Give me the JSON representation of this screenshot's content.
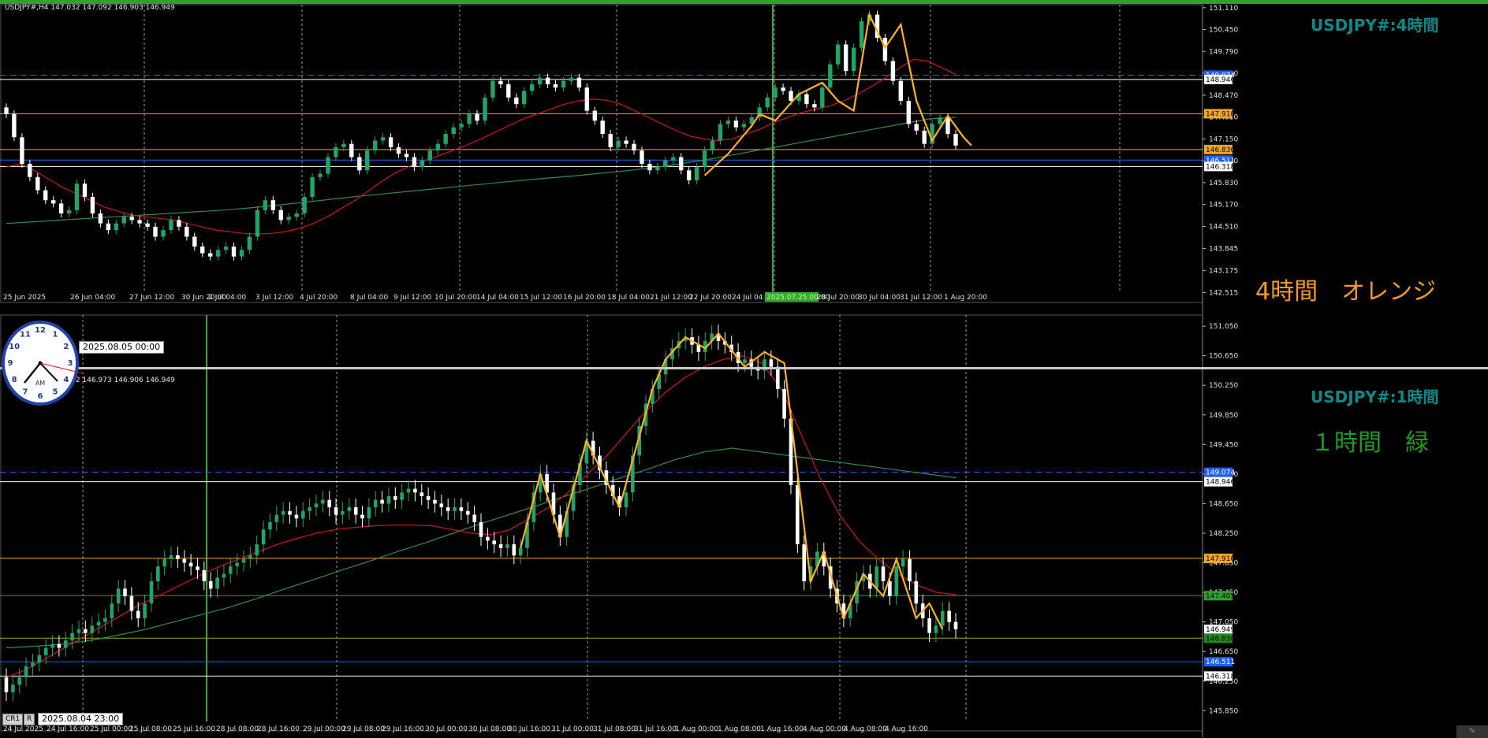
{
  "symbol": "USDJPY#",
  "colors": {
    "bull": "#21a567",
    "bear": "#ffffff",
    "ema_red": "#d11414",
    "ema_green": "#2e8b57",
    "zigzag": "#ffb020",
    "orange_line": "#f5a623",
    "blue_line": "#1e5eff",
    "white_line": "#ffffff",
    "green_line": "#2ea02e",
    "vgrid": "#9a9a9a",
    "accent_green": "#36a836"
  },
  "panels": [
    {
      "id": "h4",
      "info_text": "USDJPY#,H4  147.032 147.092 146.903 146.949",
      "title": "USDJPY#:4時間",
      "note": "4時間　オレンジ",
      "note_color": "#f59a1a",
      "y_ticks": [
        151.11,
        150.45,
        149.79,
        149.13,
        148.47,
        147.81,
        147.15,
        146.49,
        145.83,
        145.17,
        144.51,
        143.845,
        143.175,
        142.515
      ],
      "y_tick_labels": [
        "151.110",
        "150.450",
        "149.790",
        "149.130",
        "148.470",
        "147.810",
        "147.150",
        "146.490",
        "145.830",
        "145.170",
        "144.510",
        "143.845",
        "143.175",
        "142.515"
      ],
      "ylim": [
        142.5,
        151.2
      ],
      "x_labels": [
        "25 Jun 2025",
        "26 Jun 04:00",
        "27 Jun 12:00",
        "30 Jun 20:00",
        "2 Jul 04:00",
        "3 Jul 12:00",
        "4 Jul 20:00",
        "8 Jul 04:00",
        "9 Jul 12:00",
        "10 Jul 20:00",
        "14 Jul 04:00",
        "15 Jul 12:00",
        "16 Jul 20:00",
        "18 Jul 04:00",
        "21 Jul 12:00",
        "22 Jul 20:00",
        "24 Jul 04:00",
        "2025.07.25 00:00",
        "28 Jul 20:00",
        "30 Jul 04:00",
        "31 Jul 12:00",
        "1 Aug 20:00"
      ],
      "levels": [
        {
          "price": 149.074,
          "kind": "blue_dash",
          "label": "149.074"
        },
        {
          "price": 148.946,
          "kind": "white",
          "label": "148.946"
        },
        {
          "price": 147.91,
          "kind": "orange",
          "label": "147.910"
        },
        {
          "price": 146.83,
          "kind": "orange",
          "label": "146.830"
        },
        {
          "price": 146.511,
          "kind": "blue",
          "label": "146.511"
        },
        {
          "price": 146.318,
          "kind": "white",
          "label": "146.318"
        }
      ],
      "datetime_box": "2025.08.05 00:00",
      "chart_data": {
        "type": "candlestick",
        "title": "USDJPY#:4時間",
        "note": "4時間　オレンジ",
        "close": [
          147.9,
          147.2,
          146.4,
          146.0,
          145.6,
          145.3,
          145.2,
          144.9,
          145.0,
          145.8,
          145.4,
          144.9,
          144.6,
          144.4,
          144.6,
          144.8,
          144.7,
          144.6,
          144.5,
          144.2,
          144.4,
          144.7,
          144.5,
          144.2,
          143.9,
          143.7,
          143.6,
          143.8,
          143.9,
          143.6,
          143.8,
          144.2,
          145.0,
          145.3,
          145.0,
          144.7,
          144.8,
          144.9,
          145.4,
          146.0,
          146.1,
          146.6,
          146.9,
          147.0,
          146.6,
          146.2,
          146.8,
          147.1,
          147.2,
          146.9,
          146.7,
          146.6,
          146.3,
          146.5,
          146.8,
          147.0,
          147.3,
          147.5,
          147.6,
          147.9,
          147.7,
          148.4,
          148.9,
          148.8,
          148.4,
          148.2,
          148.6,
          148.8,
          149.0,
          148.8,
          148.7,
          148.9,
          149.0,
          148.7,
          148.0,
          147.7,
          147.3,
          146.9,
          147.1,
          147.0,
          146.8,
          146.4,
          146.2,
          146.3,
          146.5,
          146.6,
          146.2,
          145.9,
          146.3,
          146.8,
          147.1,
          147.6,
          147.7,
          147.5,
          147.6,
          147.8,
          148.1,
          148.4,
          148.7,
          148.6,
          148.3,
          148.5,
          148.2,
          148.1,
          148.7,
          149.4,
          150.0,
          149.2,
          149.9,
          150.7,
          150.9,
          150.2,
          149.5,
          148.9,
          148.3,
          147.6,
          147.4,
          147.0,
          147.6,
          147.8,
          147.3,
          146.95
        ],
        "ema_red": [
          146.3,
          146.4,
          146.2,
          145.95,
          145.7,
          145.5,
          145.3,
          145.1,
          144.97,
          144.85,
          144.8,
          144.75,
          144.7,
          144.6,
          144.5,
          144.4,
          144.35,
          144.3,
          144.28,
          144.3,
          144.35,
          144.45,
          144.6,
          144.8,
          145.05,
          145.3,
          145.6,
          145.9,
          146.15,
          146.35,
          146.5,
          146.65,
          146.8,
          146.97,
          147.15,
          147.35,
          147.55,
          147.75,
          147.9,
          148.05,
          148.2,
          148.3,
          148.35,
          148.32,
          148.2,
          148.0,
          147.8,
          147.6,
          147.4,
          147.23,
          147.15,
          147.1,
          147.15,
          147.3,
          147.45,
          147.65,
          147.8,
          147.95,
          148.05,
          148.15,
          148.3,
          148.5,
          148.75,
          149.0,
          149.3,
          149.55,
          149.5,
          149.3,
          149.1
        ],
        "ema_green": [
          144.6,
          144.65,
          144.7,
          144.75,
          144.8,
          144.85,
          144.9,
          144.95,
          145.0,
          145.07,
          145.15,
          145.24,
          145.33,
          145.42,
          145.5,
          145.58,
          145.66,
          145.74,
          145.82,
          145.9,
          145.97,
          146.04,
          146.12,
          146.2,
          146.3,
          146.42,
          146.55,
          146.7,
          146.85,
          147.0,
          147.15,
          147.3,
          147.45,
          147.6,
          147.75,
          147.8
        ],
        "zigzag": [
          [
            89,
            146.05
          ],
          [
            92,
            146.7
          ],
          [
            95,
            147.55
          ],
          [
            96,
            147.9
          ],
          [
            98,
            147.7
          ],
          [
            101,
            148.5
          ],
          [
            104,
            148.85
          ],
          [
            106,
            148.3
          ],
          [
            108,
            148.0
          ],
          [
            110,
            150.9
          ],
          [
            112,
            149.9
          ],
          [
            114,
            150.6
          ],
          [
            116,
            148.3
          ],
          [
            118,
            147.1
          ],
          [
            120,
            147.85
          ],
          [
            122,
            147.2
          ],
          [
            123,
            146.95
          ]
        ],
        "ylim": [
          142.5,
          151.2
        ]
      }
    },
    {
      "id": "h1",
      "info_text": "USDJPY#,H1  147.032 146.973 146.906 146.949",
      "title": "USDJPY#:1時間",
      "note": "１時間　緑",
      "note_color": "#1f9a1f",
      "y_ticks": [
        151.05,
        150.65,
        150.25,
        149.85,
        149.45,
        149.05,
        148.65,
        148.25,
        147.85,
        147.45,
        147.05,
        146.65,
        146.25,
        145.85
      ],
      "y_tick_labels": [
        "151.050",
        "150.650",
        "150.250",
        "149.850",
        "149.450",
        "149.050",
        "148.650",
        "148.250",
        "147.850",
        "147.450",
        "147.050",
        "146.650",
        "146.250",
        "145.850"
      ],
      "ylim": [
        145.8,
        151.2
      ],
      "x_labels": [
        "24 Jul 2025",
        "24 Jul 16:00",
        "25 Jul 00:00",
        "25 Jul 08:00",
        "25 Jul 16:00",
        "28 Jul 08:00",
        "28 Jul 16:00",
        "29 Jul 00:00",
        "29 Jul 08:00",
        "29 Jul 16:00",
        "30 Jul 00:00",
        "30 Jul 08:00",
        "30 Jul 16:00",
        "31 Jul 00:00",
        "31 Jul 08:00",
        "31 Jul 16:00",
        "1 Aug 00:00",
        "1 Aug 08:00",
        "1 Aug 16:00",
        "4 Aug 00:00",
        "4 Aug 08:00",
        "4 Aug 16:00"
      ],
      "levels": [
        {
          "price": 149.074,
          "kind": "blue_dash",
          "label": "149.074"
        },
        {
          "price": 148.946,
          "kind": "white",
          "label": "148.946"
        },
        {
          "price": 147.91,
          "kind": "orange",
          "label": "147.910"
        },
        {
          "price": 147.405,
          "kind": "green",
          "label": "147.405"
        },
        {
          "price": 146.949,
          "kind": "price",
          "label": "146.949"
        },
        {
          "price": 146.83,
          "kind": "olive",
          "label": "146.830"
        },
        {
          "price": 146.511,
          "kind": "blue",
          "label": "146.511"
        },
        {
          "price": 146.318,
          "kind": "white",
          "label": "146.318"
        }
      ],
      "datetime_box": "2025.08.04 23:00",
      "mini_buttons": [
        "CR1",
        "R"
      ],
      "chart_data": {
        "type": "candlestick",
        "title": "USDJPY#:1時間",
        "note": "１時間　緑",
        "close": [
          146.1,
          146.2,
          146.3,
          146.45,
          146.5,
          146.6,
          146.7,
          146.75,
          146.7,
          146.8,
          146.9,
          146.95,
          146.9,
          147.0,
          147.05,
          147.1,
          147.3,
          147.5,
          147.4,
          147.2,
          147.1,
          147.3,
          147.6,
          147.8,
          147.9,
          147.95,
          147.9,
          147.85,
          147.8,
          147.75,
          147.6,
          147.5,
          147.65,
          147.7,
          147.8,
          147.85,
          147.9,
          147.95,
          148.1,
          148.3,
          148.4,
          148.5,
          148.55,
          148.5,
          148.45,
          148.55,
          148.6,
          148.65,
          148.7,
          148.6,
          148.5,
          148.55,
          148.6,
          148.5,
          148.45,
          148.6,
          148.7,
          148.65,
          148.75,
          148.7,
          148.8,
          148.85,
          148.8,
          148.75,
          148.7,
          148.65,
          148.6,
          148.55,
          148.6,
          148.55,
          148.5,
          148.4,
          148.2,
          148.15,
          148.1,
          148.05,
          148.1,
          147.95,
          148.05,
          148.4,
          148.8,
          149.05,
          148.8,
          148.5,
          148.2,
          148.55,
          148.9,
          149.2,
          149.5,
          149.3,
          149.1,
          148.9,
          148.75,
          148.6,
          148.8,
          149.3,
          149.7,
          150.0,
          150.2,
          150.4,
          150.6,
          150.75,
          150.85,
          150.9,
          150.8,
          150.7,
          150.85,
          150.95,
          150.85,
          150.8,
          150.7,
          150.55,
          150.6,
          150.5,
          150.45,
          150.6,
          150.5,
          150.2,
          149.8,
          148.9,
          148.1,
          147.6,
          147.8,
          148.0,
          147.8,
          147.5,
          147.3,
          147.1,
          147.3,
          147.6,
          147.7,
          147.5,
          147.8,
          147.6,
          147.4,
          147.8,
          147.9,
          147.6,
          147.3,
          147.1,
          146.9,
          147.0,
          147.2,
          147.05,
          146.95
        ],
        "ema_red": [
          146.3,
          146.4,
          146.55,
          146.7,
          146.85,
          147.0,
          147.15,
          147.3,
          147.42,
          147.55,
          147.68,
          147.8,
          147.9,
          148.0,
          148.1,
          148.18,
          148.25,
          148.3,
          148.33,
          148.35,
          148.36,
          148.36,
          148.35,
          148.3,
          148.25,
          148.23,
          148.3,
          148.45,
          148.6,
          148.8,
          149.05,
          149.3,
          149.6,
          149.9,
          150.15,
          150.35,
          150.5,
          150.6,
          150.65,
          150.55,
          150.2,
          149.6,
          149.0,
          148.5,
          148.15,
          147.9,
          147.7,
          147.55,
          147.45,
          147.42
        ],
        "ema_green": [
          146.7,
          146.72,
          146.75,
          146.8,
          146.87,
          146.95,
          147.05,
          147.15,
          147.25,
          147.37,
          147.5,
          147.62,
          147.75,
          147.87,
          148.0,
          148.12,
          148.25,
          148.38,
          148.5,
          148.62,
          148.75,
          148.87,
          149.0,
          149.12,
          149.25,
          149.35,
          149.4,
          149.35,
          149.3,
          149.25,
          149.2,
          149.15,
          149.1,
          149.05,
          149.0
        ],
        "zigzag": [
          [
            78,
            148.05
          ],
          [
            81,
            149.05
          ],
          [
            84,
            148.2
          ],
          [
            88,
            149.5
          ],
          [
            93,
            148.6
          ],
          [
            98,
            150.2
          ],
          [
            100,
            150.6
          ],
          [
            103,
            150.9
          ],
          [
            106,
            150.75
          ],
          [
            108,
            150.95
          ],
          [
            112,
            150.5
          ],
          [
            115,
            150.7
          ],
          [
            118,
            150.55
          ],
          [
            122,
            147.6
          ],
          [
            124,
            148.0
          ],
          [
            127,
            147.1
          ],
          [
            130,
            147.7
          ],
          [
            133,
            147.4
          ],
          [
            135,
            147.9
          ],
          [
            138,
            147.1
          ],
          [
            140,
            147.3
          ],
          [
            142,
            146.95
          ]
        ],
        "ylim": [
          145.8,
          151.2
        ]
      }
    }
  ],
  "clock": {
    "numbers": [
      "12",
      "1",
      "2",
      "3",
      "4",
      "5",
      "6",
      "7",
      "8",
      "9",
      "10",
      "11"
    ],
    "am": "AM"
  },
  "corner_icon": "pencil-icon"
}
